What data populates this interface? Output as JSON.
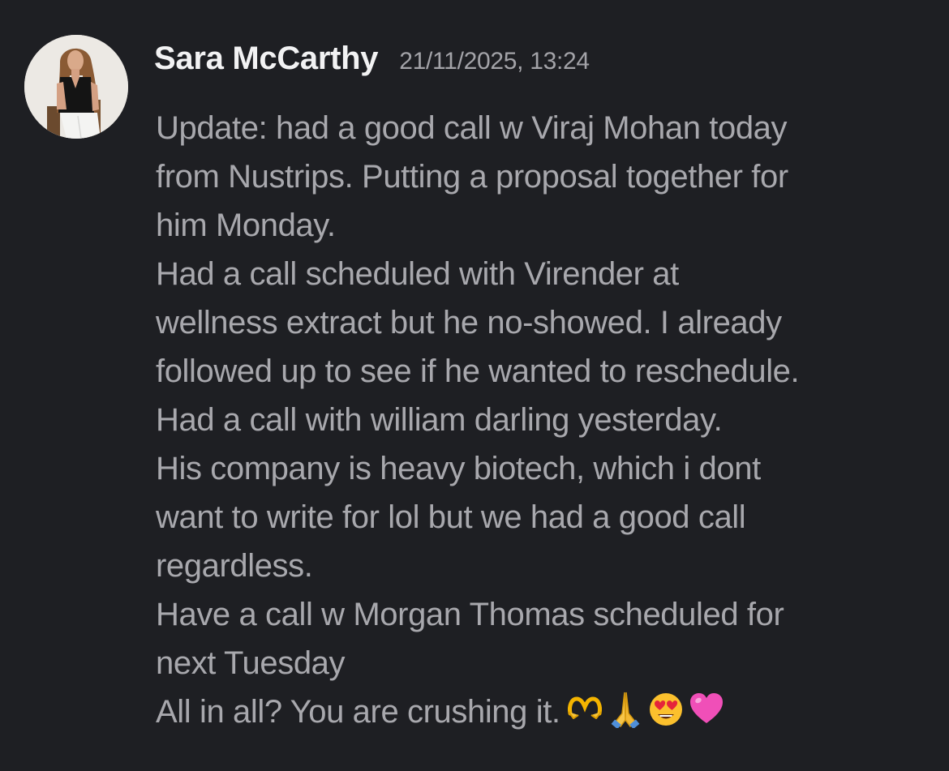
{
  "message": {
    "author": "Sara McCarthy",
    "timestamp": "21/11/2025, 13:24",
    "lines": [
      "Update: had a good call w Viraj Mohan today",
      "from Nustrips. Putting a proposal together for",
      "him Monday.",
      "Had a call scheduled with Virender at",
      "wellness extract but he no-showed. I already",
      "followed up to see if he wanted to reschedule.",
      "Had a call with william darling yesterday.",
      "His company is heavy biotech, which i dont",
      "want to write for lol but we had a good call",
      "regardless.",
      "Have a call w Morgan Thomas scheduled for",
      "next Tuesday",
      "All in all? You are crushing it."
    ],
    "emojis": [
      "heart-hands-icon",
      "folded-hands-icon",
      "heart-eyes-face-icon",
      "pink-heart-icon"
    ]
  }
}
